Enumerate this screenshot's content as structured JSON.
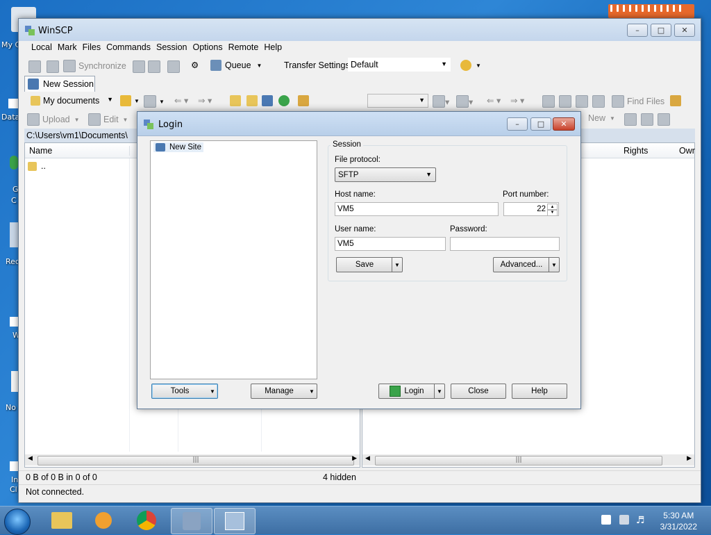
{
  "desktop": {
    "icon_labels": [
      "My C",
      "Data",
      "G",
      "C",
      "Rec",
      "W",
      "No",
      "In",
      "Cl"
    ]
  },
  "winscp": {
    "title": "WinSCP",
    "menu": [
      "Local",
      "Mark",
      "Files",
      "Commands",
      "Session",
      "Options",
      "Remote",
      "Help"
    ],
    "toolbar": {
      "synchronize": "Synchronize",
      "queue": "Queue",
      "transfer_settings_label": "Transfer Settings",
      "transfer_settings_value": "Default"
    },
    "tab": "New Session",
    "left_panel": {
      "location": "My documents",
      "upload": "Upload",
      "edit": "Edit",
      "path": "C:\\Users\\vm1\\Documents\\",
      "column_name": "Name",
      "parent_dir": ".."
    },
    "right_panel": {
      "find_files": "Find Files",
      "new": "New",
      "column_rights": "Rights",
      "column_owner": "Owr"
    },
    "status": {
      "selection": "0 B of 0 B in 0 of 0",
      "hidden": "4 hidden",
      "connection": "Not connected."
    }
  },
  "login": {
    "title": "Login",
    "site_tree": [
      "New Site"
    ],
    "session_group": "Session",
    "file_protocol_label": "File protocol:",
    "file_protocol_value": "SFTP",
    "host_name_label": "Host name:",
    "host_name_value": "VM5",
    "port_label": "Port number:",
    "port_value": "22",
    "user_name_label": "User name:",
    "user_name_value": "VM5",
    "password_label": "Password:",
    "password_value": "",
    "buttons": {
      "save": "Save",
      "advanced": "Advanced...",
      "tools": "Tools",
      "manage": "Manage",
      "login": "Login",
      "close": "Close",
      "help": "Help"
    }
  },
  "taskbar": {
    "time": "5:30 AM",
    "date": "3/31/2022"
  }
}
